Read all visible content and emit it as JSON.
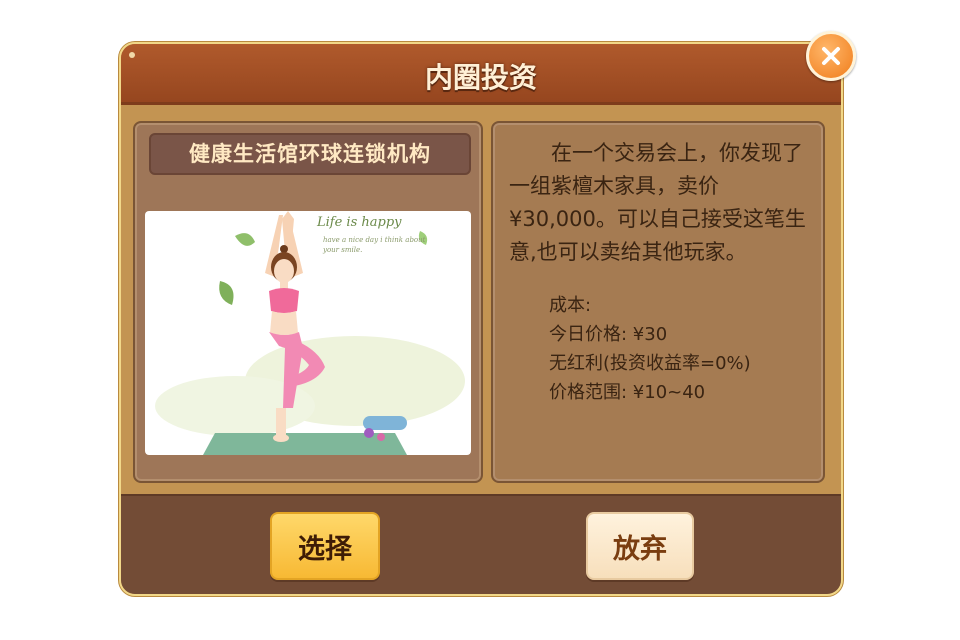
{
  "dialog": {
    "title": "内圈投资",
    "close_icon": "close-icon",
    "accent_color": "#f07c1a"
  },
  "company": {
    "name": "健康生活馆环球连锁机构",
    "image": {
      "subject": "yoga-woman-illustration",
      "script_title": "Life is happy",
      "script_subtitle": "have a nice day i think about your smile."
    }
  },
  "description": "在一个交易会上，你发现了一组紫檀木家具，卖价¥30,000。可以自己接受这笔生意,也可以卖给其他玩家。",
  "stats": {
    "cost_label": "成本:",
    "today_price": "今日价格: ¥30",
    "dividend": "无红利(投资收益率=0%)",
    "price_range": "价格范围: ¥10~40"
  },
  "buttons": {
    "select_label": "选择",
    "abandon_label": "放弃"
  }
}
